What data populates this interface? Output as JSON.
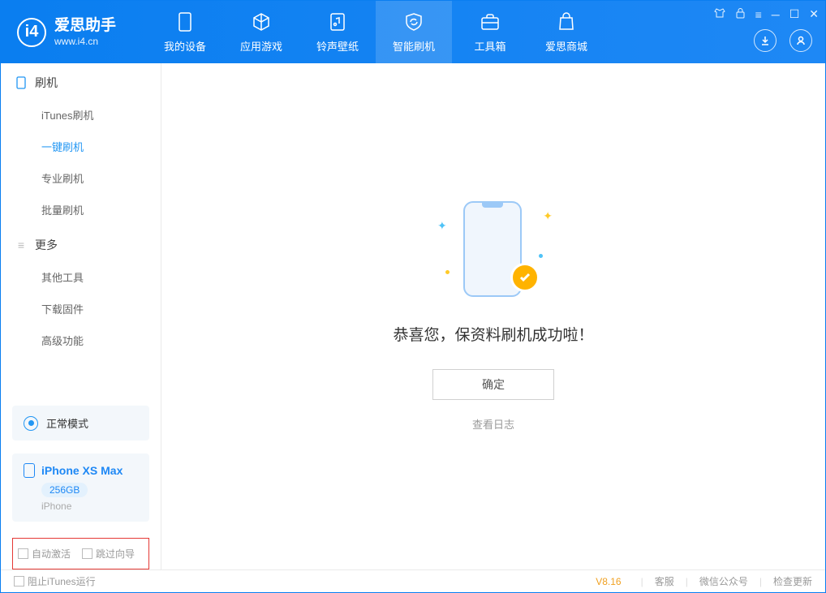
{
  "app": {
    "name": "爱思助手",
    "url": "www.i4.cn"
  },
  "tabs": {
    "device": "我的设备",
    "apps": "应用游戏",
    "ringtones": "铃声壁纸",
    "flash": "智能刷机",
    "toolbox": "工具箱",
    "store": "爱思商城"
  },
  "sidebar": {
    "section_flash": "刷机",
    "items_flash": [
      "iTunes刷机",
      "一键刷机",
      "专业刷机",
      "批量刷机"
    ],
    "section_more": "更多",
    "items_more": [
      "其他工具",
      "下载固件",
      "高级功能"
    ]
  },
  "mode": {
    "label": "正常模式"
  },
  "device": {
    "name": "iPhone XS Max",
    "storage": "256GB",
    "type": "iPhone"
  },
  "options": {
    "auto_activate": "自动激活",
    "skip_guide": "跳过向导"
  },
  "main": {
    "success": "恭喜您，保资料刷机成功啦！",
    "ok": "确定",
    "log": "查看日志"
  },
  "footer": {
    "block_itunes": "阻止iTunes运行",
    "version": "V8.16",
    "support": "客服",
    "wechat": "微信公众号",
    "update": "检查更新"
  }
}
